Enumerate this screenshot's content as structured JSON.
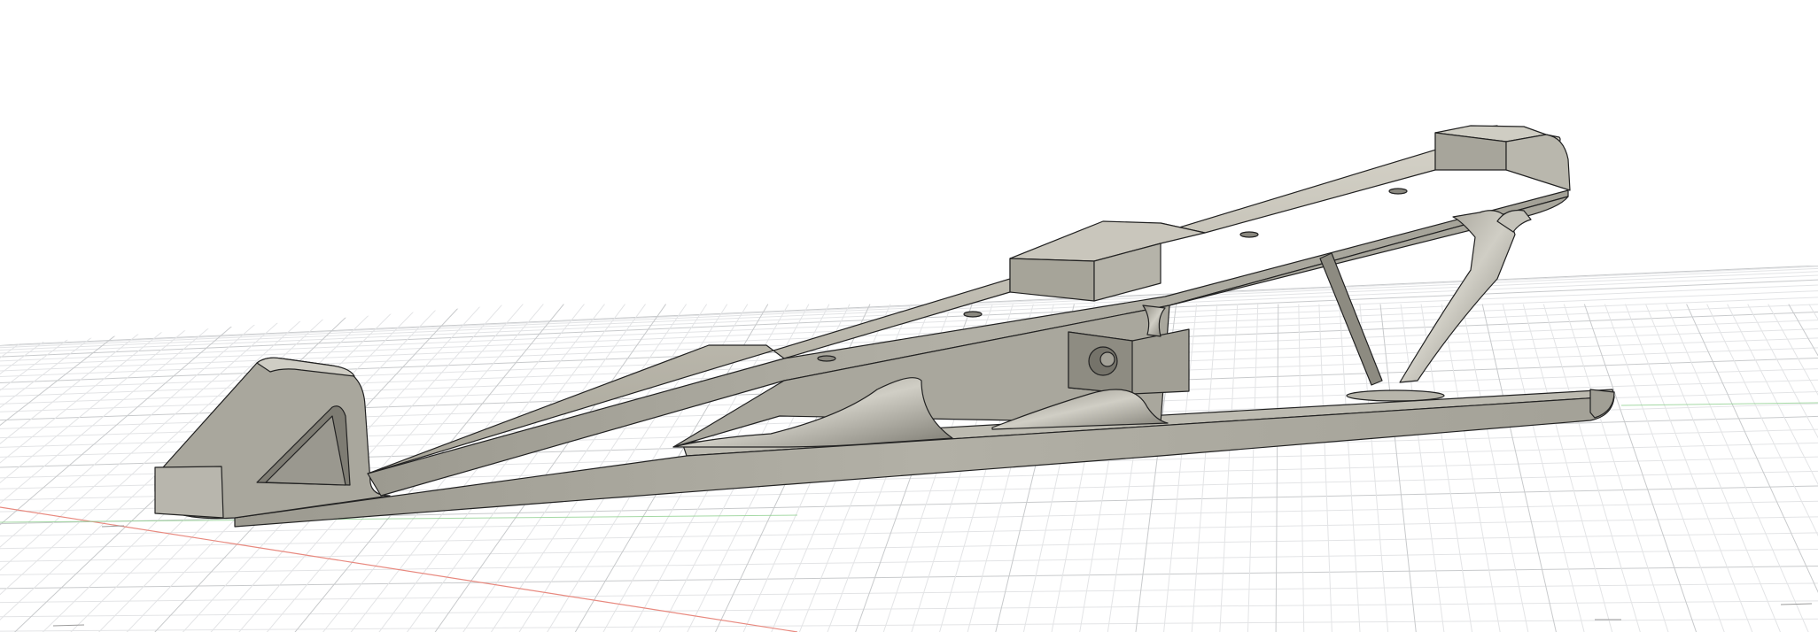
{
  "viewport": {
    "background": "#ffffff",
    "grid_color": "#c8cacc",
    "grid_minor_color": "#e3e4e6",
    "x_axis_color": "#e8897f",
    "y_axis_color": "#8fd08f"
  },
  "model": {
    "body_color": "#a9a79c",
    "body_light": "#c3c1b8",
    "body_dark": "#8e8c82",
    "edge_color": "#222222"
  },
  "icons": {
    "origin_marker": "origin-icon"
  }
}
